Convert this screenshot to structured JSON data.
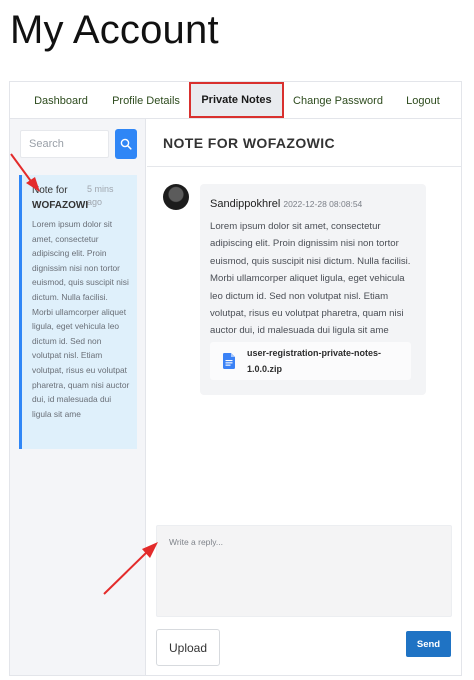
{
  "page": {
    "title": "My Account"
  },
  "tabs": [
    {
      "label": "Dashboard"
    },
    {
      "label": "Profile Details"
    },
    {
      "label": "Private Notes",
      "active": true
    },
    {
      "label": "Change Password"
    },
    {
      "label": "Logout"
    }
  ],
  "sidebar": {
    "search": {
      "placeholder": "Search",
      "icon": "search-icon"
    },
    "note": {
      "title_line1": "Note for",
      "title_line2": "WOFAZOWI",
      "time": "5 mins ago",
      "preview": "Lorem ipsum dolor sit amet, consectetur adipiscing elit. Proin dignissim nisi non tortor euismod, quis suscipit nisi dictum. Nulla facilisi. Morbi ullamcorper aliquet ligula, eget vehicula leo dictum id. Sed non volutpat nisl. Etiam volutpat, risus eu volutpat pharetra, quam nisi auctor dui, id malesuada dui ligula sit ame"
    }
  },
  "conversation": {
    "title": "NOTE FOR WOFAZOWIC",
    "message": {
      "author": "Sandippokhrel",
      "timestamp": "2022-12-28 08:08:54",
      "text": "Lorem ipsum dolor sit amet, consectetur adipiscing elit. Proin dignissim nisi non tortor euismod, quis suscipit nisi dictum. Nulla facilisi. Morbi ullamcorper aliquet ligula, eget vehicula leo dictum id. Sed non volutpat nisl. Etiam volutpat, risus eu volutpat pharetra, quam nisi auctor dui, id malesuada dui ligula sit ame",
      "attachment": {
        "name": "user-registration-private-notes-1.0.0.zip",
        "icon": "document-icon"
      }
    }
  },
  "composer": {
    "placeholder": "Write a reply...",
    "upload_label": "Upload",
    "send_label": "Send"
  },
  "colors": {
    "accent": "#2f86f6",
    "send": "#1f73c4",
    "active_tab_border": "#d9302e",
    "annotation_arrow": "#e32b2b"
  }
}
